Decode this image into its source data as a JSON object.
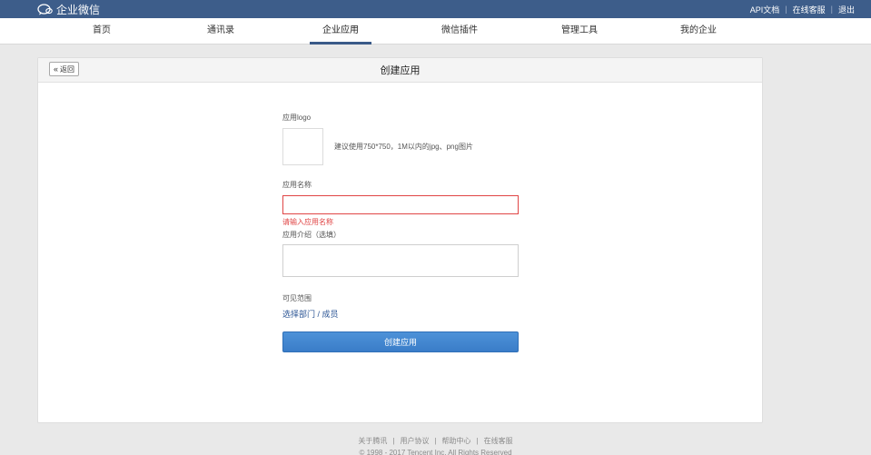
{
  "topbar": {
    "brand": "企业微信",
    "links": [
      "API文档",
      "在线客服",
      "退出"
    ]
  },
  "nav": {
    "items": [
      "首页",
      "通讯录",
      "企业应用",
      "微信插件",
      "管理工具",
      "我的企业"
    ],
    "active": "企业应用"
  },
  "card": {
    "back_label": "返回",
    "title": "创建应用"
  },
  "form": {
    "logo_label": "应用logo",
    "logo_hint": "建议使用750*750，1M以内的jpg、png图片",
    "name_label": "应用名称",
    "name_value": "",
    "name_error": "请输入应用名称",
    "intro_label": "应用介绍（选填）",
    "intro_value": "",
    "scope_label": "可见范围",
    "scope_link": "选择部门 / 成员",
    "submit_label": "创建应用"
  },
  "footer": {
    "links": [
      "关于腾讯",
      "用户协议",
      "帮助中心",
      "在线客服"
    ],
    "copyright": "© 1998 - 2017 Tencent Inc. All Rights Reserved"
  },
  "colors": {
    "topbar": "#3d5d8a",
    "accent": "#3a7dc8",
    "error": "#e04545",
    "link": "#2a5494"
  }
}
